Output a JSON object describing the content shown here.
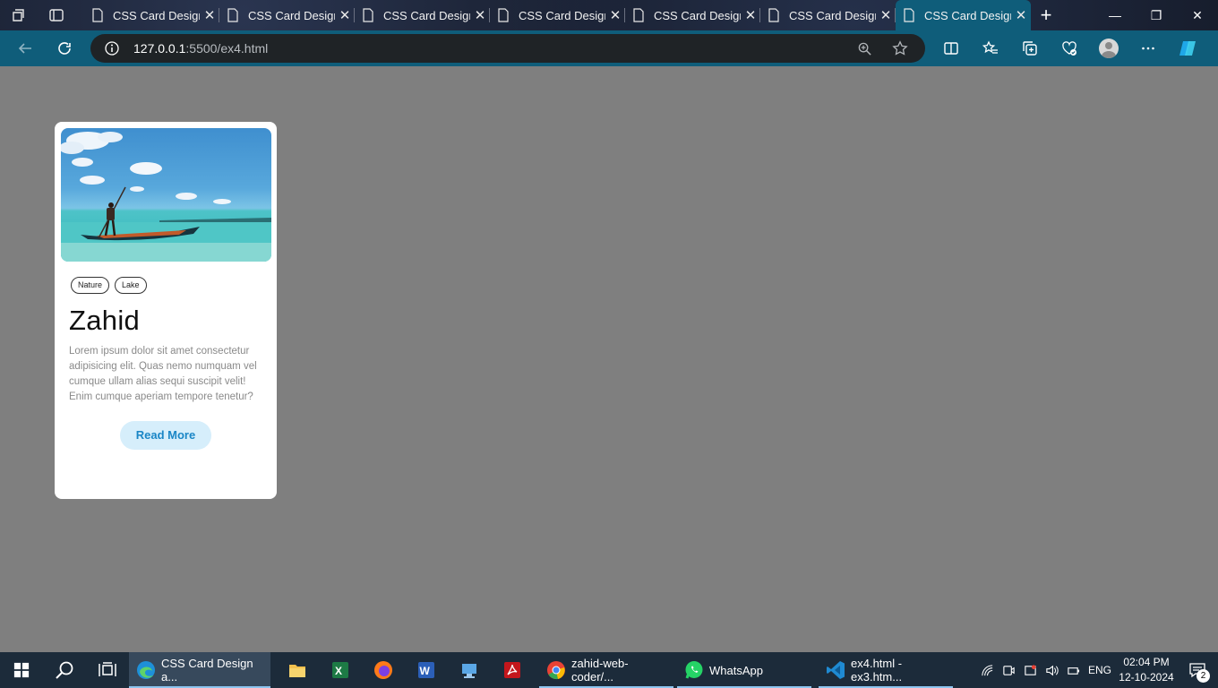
{
  "browser": {
    "tabs": [
      {
        "title": "CSS Card Design",
        "active": false
      },
      {
        "title": "CSS Card Design",
        "active": false
      },
      {
        "title": "CSS Card Design",
        "active": false
      },
      {
        "title": "CSS Card Design",
        "active": false
      },
      {
        "title": "CSS Card Design",
        "active": false
      },
      {
        "title": "CSS Card Design",
        "active": false
      },
      {
        "title": "CSS Card Design",
        "active": true
      }
    ],
    "url_host": "127.0.0.1",
    "url_path": ":5500/ex4.html",
    "accent_color": "#0f5d7a"
  },
  "card": {
    "tags": [
      "Nature",
      "Lake"
    ],
    "title": "Zahid",
    "text": "Lorem ipsum dolor sit amet consectetur adipisicing elit. Quas nemo numquam vel cumque ullam alias sequi suscipit velit! Enim cumque aperiam tempore tenetur?",
    "button_label": "Read More",
    "image_icon": "lake-boat-photo"
  },
  "taskbar": {
    "apps": [
      {
        "label": "CSS Card Design a...",
        "icon": "edge-icon",
        "active": true
      },
      {
        "label": "",
        "icon": "file-explorer-icon"
      },
      {
        "label": "",
        "icon": "excel-icon"
      },
      {
        "label": "",
        "icon": "firefox-icon"
      },
      {
        "label": "",
        "icon": "word-icon"
      },
      {
        "label": "",
        "icon": "computer-icon"
      },
      {
        "label": "",
        "icon": "acrobat-icon"
      },
      {
        "label": "zahid-web-coder/...",
        "icon": "chrome-icon"
      },
      {
        "label": "WhatsApp",
        "icon": "whatsapp-icon"
      },
      {
        "label": "ex4.html - ex3.htm...",
        "icon": "vscode-icon"
      }
    ],
    "language": "ENG",
    "time": "02:04 PM",
    "date": "12-10-2024",
    "notification_count": "2"
  }
}
